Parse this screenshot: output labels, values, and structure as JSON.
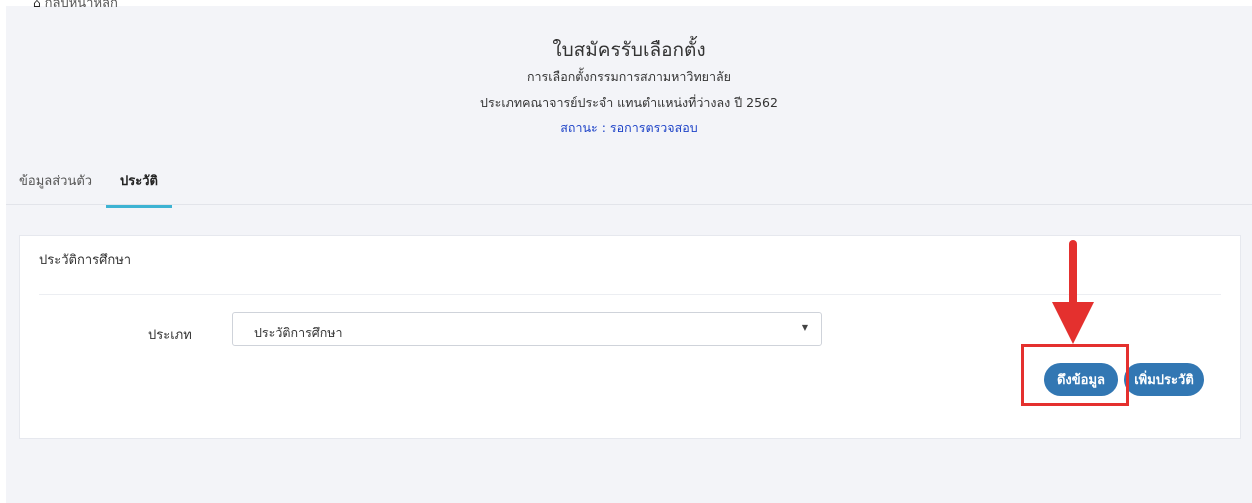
{
  "nav": {
    "back_label": "กลับหน้าหลัก",
    "home_icon": "home-icon"
  },
  "header": {
    "title": "ใบสมัครรับเลือกตั้ง",
    "subtitle": "การเลือกตั้งกรรมการสภามหาวิทยาลัย",
    "category": "ประเภทคณาจารย์ประจำ แทนตำแหน่งที่ว่างลง ปี 2562",
    "status": "สถานะ : รอการตรวจสอบ"
  },
  "tabs": [
    {
      "label": "ข้อมูลส่วนตัว",
      "active": false
    },
    {
      "label": "ประวัติ",
      "active": true
    }
  ],
  "card": {
    "title": "ประวัติการศึกษา",
    "type_label": "ประเภท",
    "type_select": {
      "value": "ประวัติการศึกษา"
    },
    "buttons": {
      "fetch": "ดึงข้อมูล",
      "add": "เพิ่มประวัติ"
    }
  },
  "colors": {
    "accent": "#3277b3",
    "tab_indicator": "#3db3d3",
    "status": "#1f44c8",
    "annotation": "#e4302e",
    "background": "#f3f4f8"
  }
}
